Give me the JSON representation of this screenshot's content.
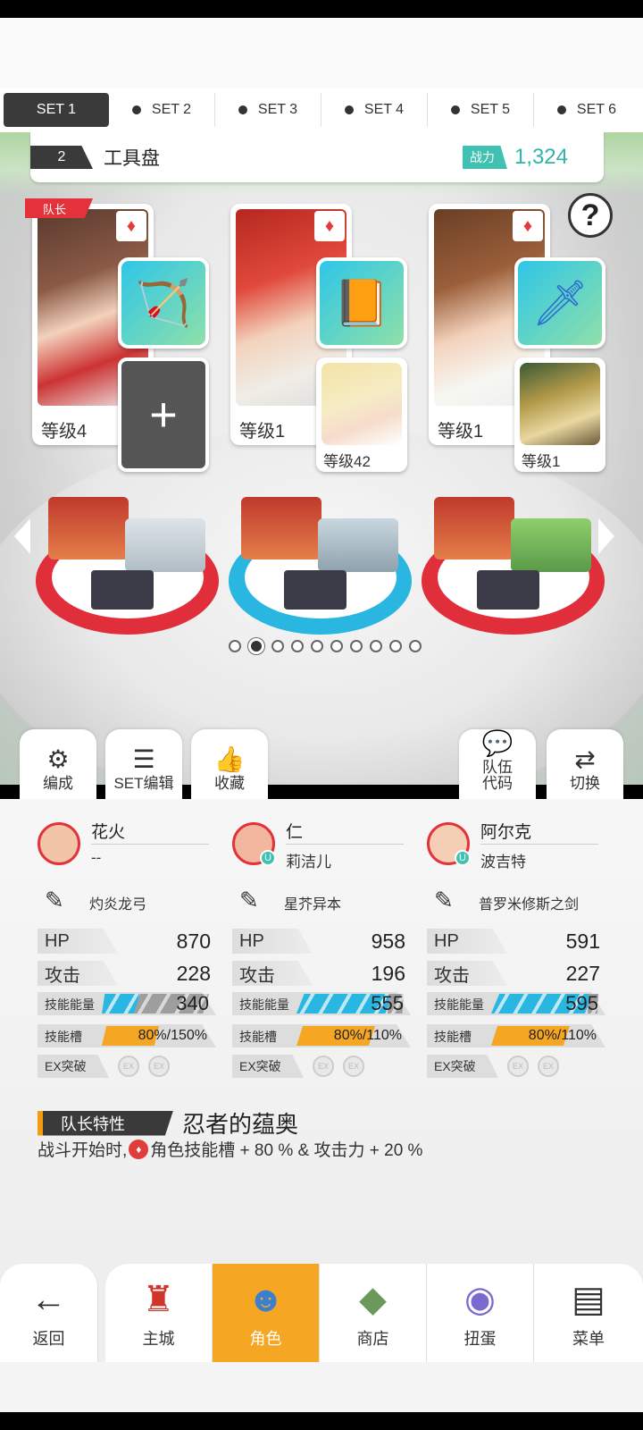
{
  "set_tabs": [
    "SET 1",
    "SET 2",
    "SET 3",
    "SET 4",
    "SET 5",
    "SET 6"
  ],
  "team": {
    "number": "2",
    "name": "工具盘",
    "power_label": "战力",
    "power_value": "1,324",
    "leader_tag": "队长",
    "help": "?"
  },
  "heroes": [
    {
      "level": "等级4",
      "sub_level": ""
    },
    {
      "level": "等级1",
      "sub_level": "等级42"
    },
    {
      "level": "等级1",
      "sub_level": "等级1"
    }
  ],
  "page_indicator": {
    "count": 10,
    "active": 1
  },
  "actions": {
    "formation": "编成",
    "set_edit": "SET编辑",
    "favorite": "收藏",
    "team_code": "队伍\n代码",
    "switch": "切换"
  },
  "members": [
    {
      "name": "花火",
      "sub": "--",
      "weapon": "灼炎龙弓",
      "hp_label": "HP",
      "hp": "870",
      "atk_label": "攻击",
      "atk": "228",
      "energy_label": "技能能量",
      "energy": "340",
      "energy_fill": 0.35,
      "slot_label": "技能槽",
      "slot": "80%/150%",
      "slot_fill": 0.53,
      "ex_label": "EX突破"
    },
    {
      "name": "仁",
      "sub": "莉洁儿",
      "weapon": "星芥异本",
      "hp_label": "HP",
      "hp": "958",
      "atk_label": "攻击",
      "atk": "196",
      "energy_label": "技能能量",
      "energy": "555",
      "energy_fill": 0.9,
      "slot_label": "技能槽",
      "slot": "80%/110%",
      "slot_fill": 0.73,
      "ex_label": "EX突破"
    },
    {
      "name": "阿尔克",
      "sub": "波吉特",
      "weapon": "普罗米修斯之剑",
      "hp_label": "HP",
      "hp": "591",
      "atk_label": "攻击",
      "atk": "227",
      "energy_label": "技能能量",
      "energy": "595",
      "energy_fill": 0.95,
      "slot_label": "技能槽",
      "slot": "80%/110%",
      "slot_fill": 0.73,
      "ex_label": "EX突破"
    }
  ],
  "leader_trait": {
    "label": "队长特性",
    "name": "忍者的蕴奥",
    "desc_prefix": "战斗开始时,",
    "desc_suffix": "角色技能槽 + 80 % & 攻击力 + 20 %"
  },
  "nav": {
    "back": "返回",
    "main_city": "主城",
    "character": "角色",
    "shop": "商店",
    "gacha": "扭蛋",
    "menu": "菜单"
  },
  "colors": {
    "accent_orange": "#f5a623",
    "power_teal": "#3fc2b2",
    "energy_blue": "#29b6e0",
    "leader_red": "#e4323a"
  }
}
